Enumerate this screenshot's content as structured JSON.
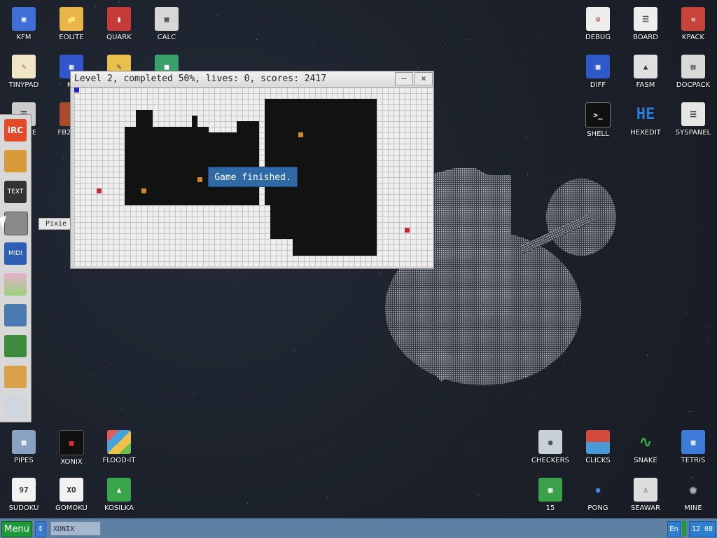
{
  "desktop_icons_top_left": [
    {
      "label": "KFM",
      "icon": "floppy-disk-icon",
      "color": "#3f6fd6"
    },
    {
      "label": "EOLITE",
      "icon": "folder-icon",
      "color": "#e9b749"
    },
    {
      "label": "QUARK",
      "icon": "book-icon",
      "color": "#c63a3a"
    },
    {
      "label": "CALC",
      "icon": "calculator-icon",
      "color": "#d7d7d7"
    },
    {
      "label": "TINYPAD",
      "icon": "notepad-icon",
      "color": "#f0e6c4"
    },
    {
      "label": "KF",
      "icon": "image-viewer-icon",
      "color": "#3355cc"
    },
    {
      "label": "E",
      "icon": "document-icon",
      "color": "#cccccc"
    },
    {
      "label": "FB2",
      "icon": "ebook-icon",
      "color": "#a94a2a"
    }
  ],
  "desktop_icons_top_right": [
    {
      "label": "DEBUG",
      "icon": "bug-icon",
      "color": "#eeeeee"
    },
    {
      "label": "BOARD",
      "icon": "clipboard-icon",
      "color": "#eeeeee"
    },
    {
      "label": "KPACK",
      "icon": "hammer-icon",
      "color": "#c8443a"
    },
    {
      "label": "DIFF",
      "icon": "diff-icon",
      "color": "#2f58c9"
    },
    {
      "label": "FASM",
      "icon": "anvil-icon",
      "color": "#e0e0e0"
    },
    {
      "label": "DOCPACK",
      "icon": "cabinet-icon",
      "color": "#d9d9d9"
    },
    {
      "label": "SHELL",
      "icon": "terminal-icon",
      "color": "#111111"
    },
    {
      "label": "HEXEDIT",
      "icon": "hex-icon",
      "color": "#2b7bdc"
    },
    {
      "label": "SYSPANEL",
      "icon": "sliders-icon",
      "color": "#e6e6e6"
    }
  ],
  "desktop_icons_bottom_left": [
    {
      "label": "PIPES",
      "icon": "pipes-icon",
      "color": "#8aa2c2"
    },
    {
      "label": "XONIX",
      "icon": "xonix-icon",
      "color": "#101010"
    },
    {
      "label": "FLOOD-IT",
      "icon": "flood-it-icon",
      "color": "#d98c3a"
    },
    {
      "label": "SUDOKU",
      "icon": "sudoku-icon",
      "color": "#f2f2f2"
    },
    {
      "label": "GOMOKU",
      "icon": "gomoku-icon",
      "color": "#f2f2f2"
    },
    {
      "label": "KOSILKA",
      "icon": "lawnmower-icon",
      "color": "#3aa64a"
    }
  ],
  "desktop_icons_bottom_right": [
    {
      "label": "CHECKERS",
      "icon": "checkers-icon",
      "color": "#c8d0da"
    },
    {
      "label": "CLICKS",
      "icon": "clicks-icon",
      "color": "#d24a3a"
    },
    {
      "label": "SNAKE",
      "icon": "snake-icon",
      "color": "#3ea547"
    },
    {
      "label": "TETRIS",
      "icon": "tetris-icon",
      "color": "#3d7bd8"
    },
    {
      "label": "15",
      "icon": "fifteen-icon",
      "color": "#3aa04a"
    },
    {
      "label": "PONG",
      "icon": "pong-icon",
      "color": "#4488dd"
    },
    {
      "label": "SEAWAR",
      "icon": "seawar-icon",
      "color": "#dddddd"
    },
    {
      "label": "MINE",
      "icon": "mine-icon",
      "color": "#777777"
    }
  ],
  "dock": {
    "items": [
      {
        "icon": "irc-icon",
        "color": "#e24a2a"
      },
      {
        "icon": "package-icon",
        "color": "#d99a3a"
      },
      {
        "icon": "text-icon",
        "color": "#333333"
      },
      {
        "icon": "speaker-icon",
        "color": "#8a8a8a"
      },
      {
        "icon": "midi-player-icon",
        "color": "#2f5fb3"
      },
      {
        "icon": "picture-icon",
        "color": "#d8a35a"
      },
      {
        "icon": "network-card-icon",
        "color": "#4a7ab0"
      },
      {
        "icon": "chip-icon",
        "color": "#3e8a3e"
      },
      {
        "icon": "volume-icon",
        "color": "#d9a14a"
      },
      {
        "icon": "settings-sliders-icon",
        "color": "#cfd6de"
      }
    ],
    "tooltip": "Pixie"
  },
  "window": {
    "title": "Level 2, completed 50%, lives: 0, scores: 2417",
    "minimize_label": "–",
    "close_label": "×",
    "message": "Game finished."
  },
  "taskbar": {
    "menu_label": "Menu",
    "arrow_label": "⇕",
    "task_label": "XONIX",
    "lang_label": "En",
    "clock_label": "12 08"
  }
}
